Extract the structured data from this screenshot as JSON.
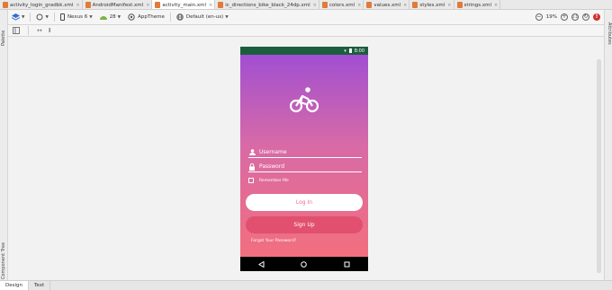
{
  "tabs": [
    {
      "label": "activity_login_gradbk.xml",
      "color": "#e07b39",
      "active": false
    },
    {
      "label": "AndroidManifest.xml",
      "color": "#e07b39",
      "active": false
    },
    {
      "label": "activity_main.xml",
      "color": "#e07b39",
      "active": true
    },
    {
      "label": "ic_directions_bike_black_24dp.xml",
      "color": "#e07b39",
      "active": false
    },
    {
      "label": "colors.xml",
      "color": "#e07b39",
      "active": false
    },
    {
      "label": "values.xml",
      "color": "#e07b39",
      "active": false
    },
    {
      "label": "styles.xml",
      "color": "#e07b39",
      "active": false
    },
    {
      "label": "strings.xml",
      "color": "#e07b39",
      "active": false
    }
  ],
  "toolbar": {
    "device": "Nexus 6",
    "api": "28",
    "theme": "AppTheme",
    "locale": "Default (en-us)",
    "zoom": "19%"
  },
  "side": {
    "palette": "Palette",
    "component_tree": "Component Tree",
    "attributes": "Attributes"
  },
  "device": {
    "time": "8:00",
    "username_hint": "Username",
    "password_hint": "Password",
    "remember_label": "Remember Me",
    "login_label": "Log In",
    "signup_label": "Sign Up",
    "forgot_label": "Forgot Your Password?"
  },
  "bottom_tabs": {
    "design": "Design",
    "text": "Text"
  },
  "colors": {
    "gradient_top": "#a14fd2",
    "gradient_bottom": "#f26f7e",
    "accent": "#e1506e"
  }
}
